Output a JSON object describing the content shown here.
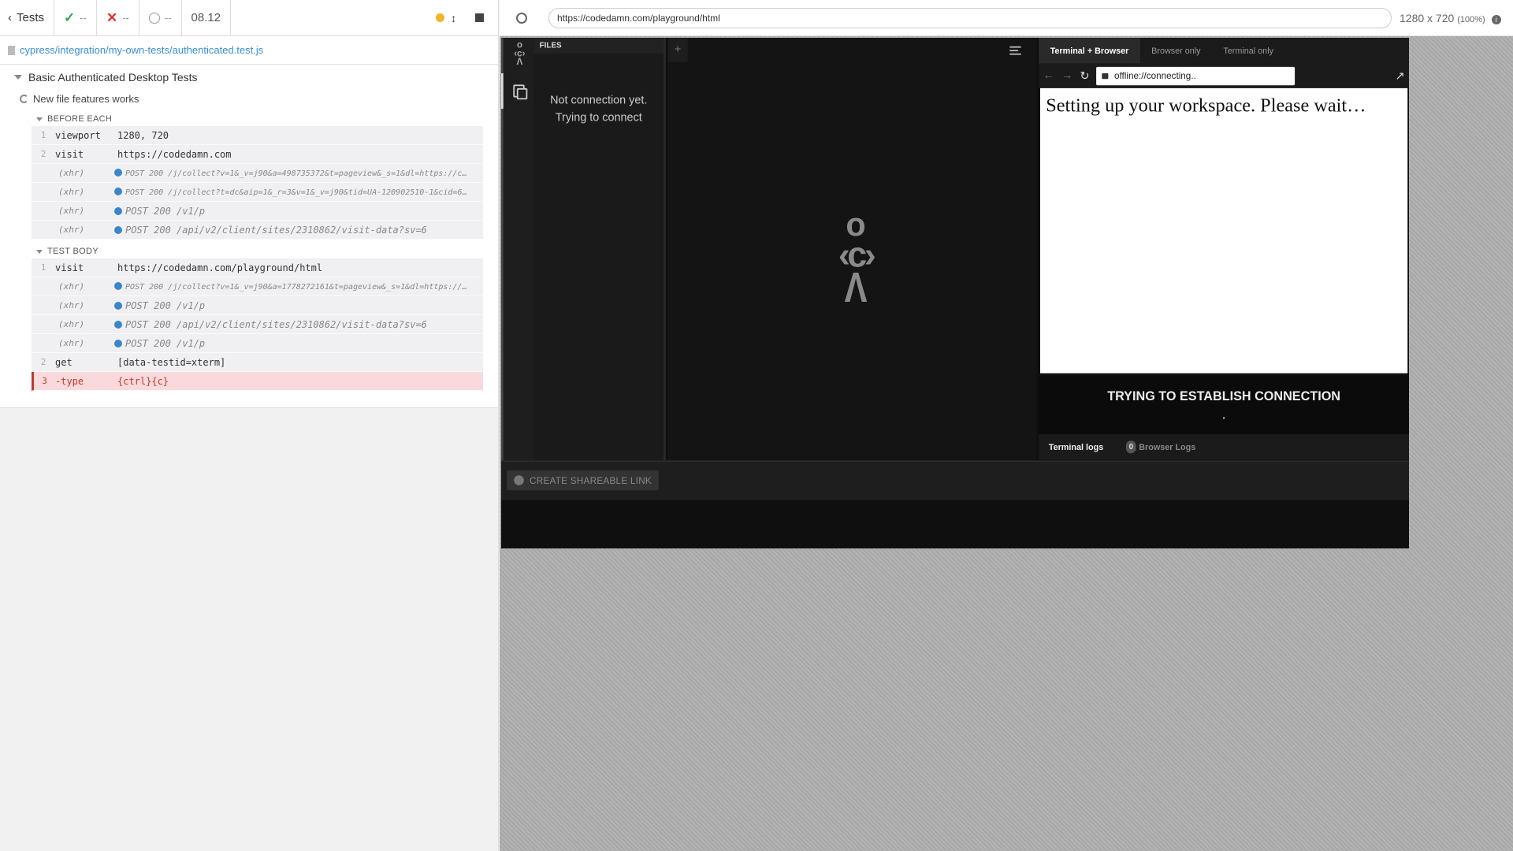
{
  "reporter": {
    "back_label": "Tests",
    "passed": "--",
    "failed": "--",
    "pending": "--",
    "duration": "08.12",
    "spec_path": "cypress/integration/my-own-tests/authenticated.test.js",
    "suite_title": "Basic Authenticated Desktop Tests",
    "test_title": "New file features works",
    "before_each_label": "BEFORE EACH",
    "test_body_label": "TEST BODY",
    "before_each": [
      {
        "num": "1",
        "name": "viewport",
        "msg": "1280, 720",
        "type": "cmd"
      },
      {
        "num": "2",
        "name": "visit",
        "msg": "https://codedamn.com",
        "type": "cmd"
      },
      {
        "num": "",
        "name": "(xhr)",
        "msg": "POST 200 /j/collect?v=1&_v=j90&a=498735372&t=pageview&_s=1&dl=https://c…",
        "type": "xhr-small"
      },
      {
        "num": "",
        "name": "(xhr)",
        "msg": "POST 200 /j/collect?t=dc&aip=1&_r=3&v=1&_v=j90&tid=UA-120902510-1&cid=6…",
        "type": "xhr-small"
      },
      {
        "num": "",
        "name": "(xhr)",
        "msg": "POST 200 /v1/p",
        "type": "xhr"
      },
      {
        "num": "",
        "name": "(xhr)",
        "msg": "POST 200 /api/v2/client/sites/2310862/visit-data?sv=6",
        "type": "xhr"
      }
    ],
    "test_body": [
      {
        "num": "1",
        "name": "visit",
        "msg": "https://codedamn.com/playground/html",
        "type": "cmd"
      },
      {
        "num": "",
        "name": "(xhr)",
        "msg": "POST 200 /j/collect?v=1&_v=j90&a=1778272161&t=pageview&_s=1&dl=https://…",
        "type": "xhr-small"
      },
      {
        "num": "",
        "name": "(xhr)",
        "msg": "POST 200 /v1/p",
        "type": "xhr"
      },
      {
        "num": "",
        "name": "(xhr)",
        "msg": "POST 200 /api/v2/client/sites/2310862/visit-data?sv=6",
        "type": "xhr"
      },
      {
        "num": "",
        "name": "(xhr)",
        "msg": "POST 200 /v1/p",
        "type": "xhr"
      },
      {
        "num": "2",
        "name": "get",
        "msg": "[data-testid=xterm]",
        "type": "cmd"
      },
      {
        "num": "3",
        "name": "-type",
        "msg": "{ctrl}{c}",
        "type": "failed"
      }
    ]
  },
  "aut": {
    "url": "https://codedamn.com/playground/html",
    "size": "1280 x 720",
    "zoom": "(100%)"
  },
  "app": {
    "files_header": "FILES",
    "files_msg_1": "Not connection yet.",
    "files_msg_2": "Trying to connect",
    "tab_add": "+",
    "tabs": [
      "Terminal + Browser",
      "Browser only",
      "Terminal only"
    ],
    "address": "offline://connecting..",
    "browser_text": "Setting up your workspace. Please wait…",
    "terminal_status": "TRYING TO ESTABLISH CONNECTION",
    "terminal_dots": ".",
    "terminal_logs": "Terminal logs",
    "browser_logs_count": "0",
    "browser_logs": "Browser Logs",
    "share_button": "CREATE SHAREABLE LINK"
  }
}
